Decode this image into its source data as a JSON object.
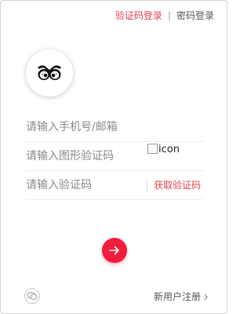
{
  "tabs": {
    "sms_login": "验证码登录",
    "separator": "|",
    "password_login": "密码登录"
  },
  "avatar": {
    "icon": "owl-eyes-logo"
  },
  "form": {
    "phone_placeholder": "请输入手机号/邮箱",
    "captcha_placeholder": "请输入图形验证码",
    "captcha_image_alt": "icon",
    "sms_code_placeholder": "请输入验证码",
    "get_code_label": "获取验证码"
  },
  "submit": {
    "icon": "arrow-right-icon"
  },
  "footer": {
    "wechat_icon": "wechat-icon",
    "register_label": "新用户注册"
  },
  "colors": {
    "accent": "#e8404d",
    "submit_bg": "#f01d3c",
    "placeholder": "#8a8a8a"
  }
}
